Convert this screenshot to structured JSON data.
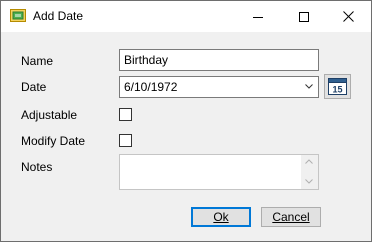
{
  "window": {
    "title": "Add Date",
    "icon": "calendar-app-icon",
    "controls": {
      "minimize": "minimize-icon",
      "maximize": "maximize-icon",
      "close": "close-icon"
    }
  },
  "form": {
    "name_label": "Name",
    "name_value": "Birthday",
    "date_label": "Date",
    "date_value": "6/10/1972",
    "calendar_button_day": "15",
    "adjustable_label": "Adjustable",
    "adjustable_checked": false,
    "modify_date_label": "Modify Date",
    "modify_date_checked": false,
    "notes_label": "Notes",
    "notes_value": ""
  },
  "buttons": {
    "ok_label": "Ok",
    "cancel_label": "Cancel"
  },
  "colors": {
    "focus_border": "#0078d7",
    "dialog_bg": "#f0f0f0",
    "titlebar_bg": "#ffffff"
  }
}
